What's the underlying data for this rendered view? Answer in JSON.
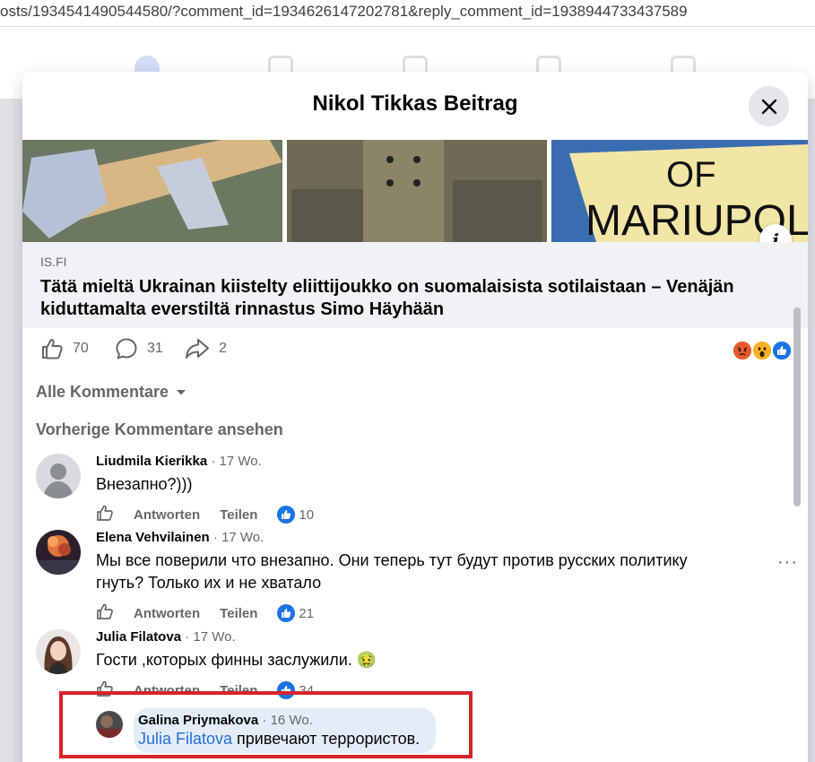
{
  "browser": {
    "url": "osts/1934541490544580/?comment_id=1934626147202781&reply_comment_id=1938944733437589"
  },
  "modal": {
    "title": "Nikol Tikkas Beitrag",
    "hero_text": [
      "OF",
      "MARIUPOL"
    ],
    "info_icon": "i"
  },
  "link": {
    "domain": "IS.FI",
    "title": "Tätä mieltä Ukrainan kiistelty eliittijoukko on suomalaisista sotilaistaan – Venäjän kiduttamalta everstiltä rinnastus Simo Häyhään"
  },
  "stats": {
    "likes": "70",
    "comments": "31",
    "shares": "2"
  },
  "comments_section": {
    "sort_label": "Alle Kommentare",
    "previous_label": "Vorherige Kommentare ansehen",
    "action_reply": "Antworten",
    "action_share": "Teilen"
  },
  "comments": [
    {
      "author": "Liudmila Kierikka",
      "time": " · 17 Wo.",
      "text": "Внезапно?)))",
      "likes": "10"
    },
    {
      "author": "Elena Vehvilainen",
      "time": " · 17 Wo.",
      "text": "Мы все поверили что внезапно. Они теперь тут будут против русских политику гнуть? Только их и не хватало",
      "likes": "21"
    },
    {
      "author": "Julia Filatova",
      "time": " · 17 Wo.",
      "text": "Гости ,которых финны заслужили. 🤢",
      "likes": "34"
    }
  ],
  "reply": {
    "author": "Galina Priymakova",
    "time": " · 16 Wo.",
    "mention": "Julia Filatova",
    "text": " привечают террористов."
  },
  "colors": {
    "accent": "#216fdb",
    "highlight": "#d8232a",
    "bubble": "#e4ecf7"
  }
}
